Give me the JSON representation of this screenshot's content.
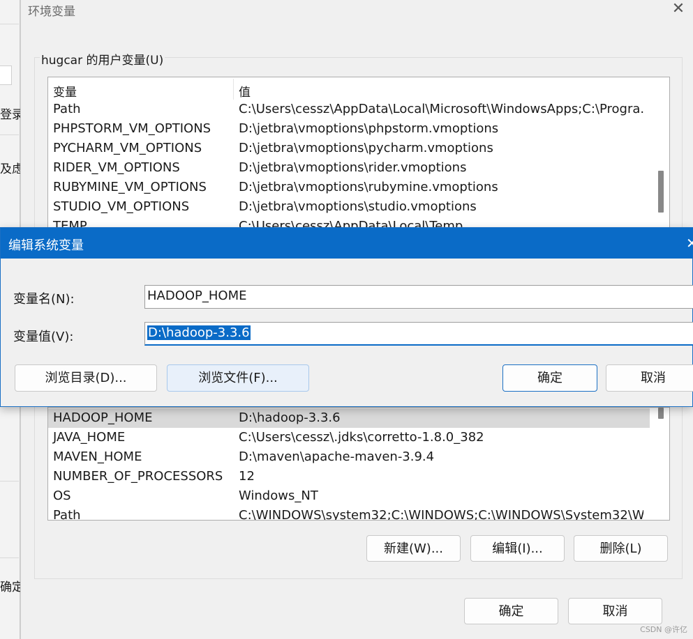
{
  "background_window": {
    "fragments": [
      "登录,",
      "及虑",
      "确定"
    ]
  },
  "env_window": {
    "title": "环境变量",
    "close_glyph": "✕",
    "user_group_label": "hugcar 的用户变量(U)",
    "user_list": {
      "headers": {
        "variable": "变量",
        "value": "值"
      },
      "rows": [
        {
          "name": "Path",
          "value": "C:\\Users\\cessz\\AppData\\Local\\Microsoft\\WindowsApps;C:\\Progra..."
        },
        {
          "name": "PHPSTORM_VM_OPTIONS",
          "value": "D:\\jetbra\\vmoptions\\phpstorm.vmoptions"
        },
        {
          "name": "PYCHARM_VM_OPTIONS",
          "value": "D:\\jetbra\\vmoptions\\pycharm.vmoptions"
        },
        {
          "name": "RIDER_VM_OPTIONS",
          "value": "D:\\jetbra\\vmoptions\\rider.vmoptions"
        },
        {
          "name": "RUBYMINE_VM_OPTIONS",
          "value": "D:\\jetbra\\vmoptions\\rubymine.vmoptions"
        },
        {
          "name": "STUDIO_VM_OPTIONS",
          "value": "D:\\jetbra\\vmoptions\\studio.vmoptions"
        },
        {
          "name": "TEMP",
          "value": "C:\\Users\\cessz\\AppData\\Local\\Temp"
        }
      ]
    },
    "system_list": {
      "rows": [
        {
          "name": "HADOOP_HOME",
          "value": "D:\\hadoop-3.3.6"
        },
        {
          "name": "JAVA_HOME",
          "value": "C:\\Users\\cessz\\.jdks\\corretto-1.8.0_382"
        },
        {
          "name": "MAVEN_HOME",
          "value": "D:\\maven\\apache-maven-3.9.4"
        },
        {
          "name": "NUMBER_OF_PROCESSORS",
          "value": "12"
        },
        {
          "name": "OS",
          "value": "Windows_NT"
        },
        {
          "name": "Path",
          "value": "C:\\WINDOWS\\system32;C:\\WINDOWS;C:\\WINDOWS\\System32\\W"
        }
      ]
    },
    "system_buttons": {
      "new": "新建(W)...",
      "edit": "编辑(I)...",
      "delete": "删除(L)"
    },
    "ok": "确定",
    "cancel": "取消"
  },
  "edit_dialog": {
    "title": "编辑系统变量",
    "close_glyph": "✕",
    "name_label": "变量名(N):",
    "name_value": "HADOOP_HOME",
    "value_label": "变量值(V):",
    "value_value": "D:\\hadoop-3.3.6",
    "browse_dir": "浏览目录(D)...",
    "browse_file": "浏览文件(F)...",
    "ok": "确定",
    "cancel": "取消"
  },
  "watermark": "CSDN @许亿",
  "colors": {
    "accent": "#0a6bc7",
    "selected_row": "#d9d9d9"
  }
}
